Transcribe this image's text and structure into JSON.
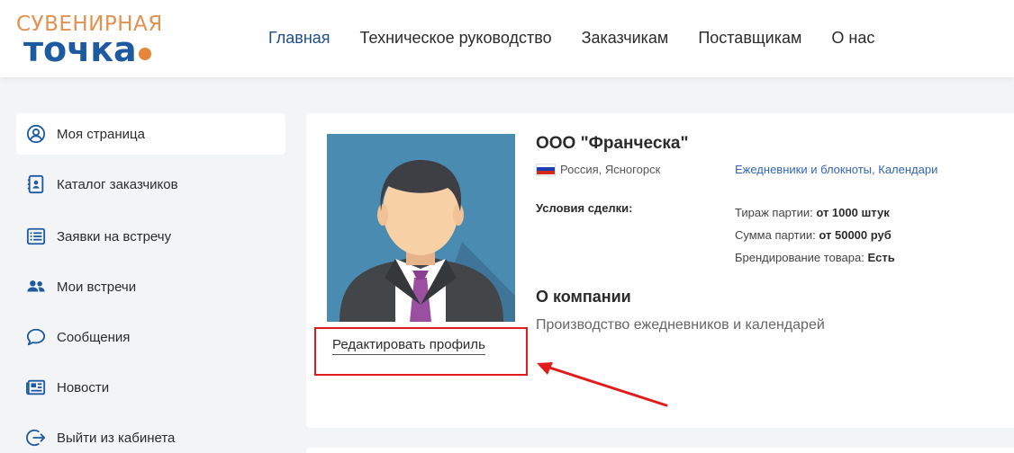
{
  "logo": {
    "top": "СУВЕНИРНАЯ",
    "bottom": "точка"
  },
  "nav": [
    "Главная",
    "Техническое руководство",
    "Заказчикам",
    "Поставщикам",
    "О нас"
  ],
  "sidebar": {
    "items": [
      {
        "label": "Моя страница",
        "icon": "user-circle-icon"
      },
      {
        "label": "Каталог заказчиков",
        "icon": "address-book-icon"
      },
      {
        "label": "Заявки на встречу",
        "icon": "list-icon"
      },
      {
        "label": "Мои встречи",
        "icon": "users-icon"
      },
      {
        "label": "Сообщения",
        "icon": "comment-icon"
      },
      {
        "label": "Новости",
        "icon": "newspaper-icon"
      },
      {
        "label": "Выйти из кабинета",
        "icon": "logout-icon"
      }
    ]
  },
  "profile": {
    "name": "ООО \"Франческа\"",
    "location": "Россия, Ясногорск",
    "category": "Ежедневники и блокноты, Календари",
    "terms_label": "Условия сделки:",
    "terms": [
      {
        "label": "Тираж партии:",
        "value": "от 1000 штук"
      },
      {
        "label": "Сумма партии:",
        "value": "от 50000 руб"
      },
      {
        "label": "Брендирование товара:",
        "value": "Есть"
      }
    ],
    "about_title": "О компании",
    "about_text": "Производство ежедневников и календарей",
    "edit_label": "Редактировать профиль"
  },
  "colors": {
    "accent_blue": "#1d5aa0",
    "accent_orange": "#e29150",
    "annotation_red": "#e01c1c",
    "link_blue": "#3466b8"
  }
}
